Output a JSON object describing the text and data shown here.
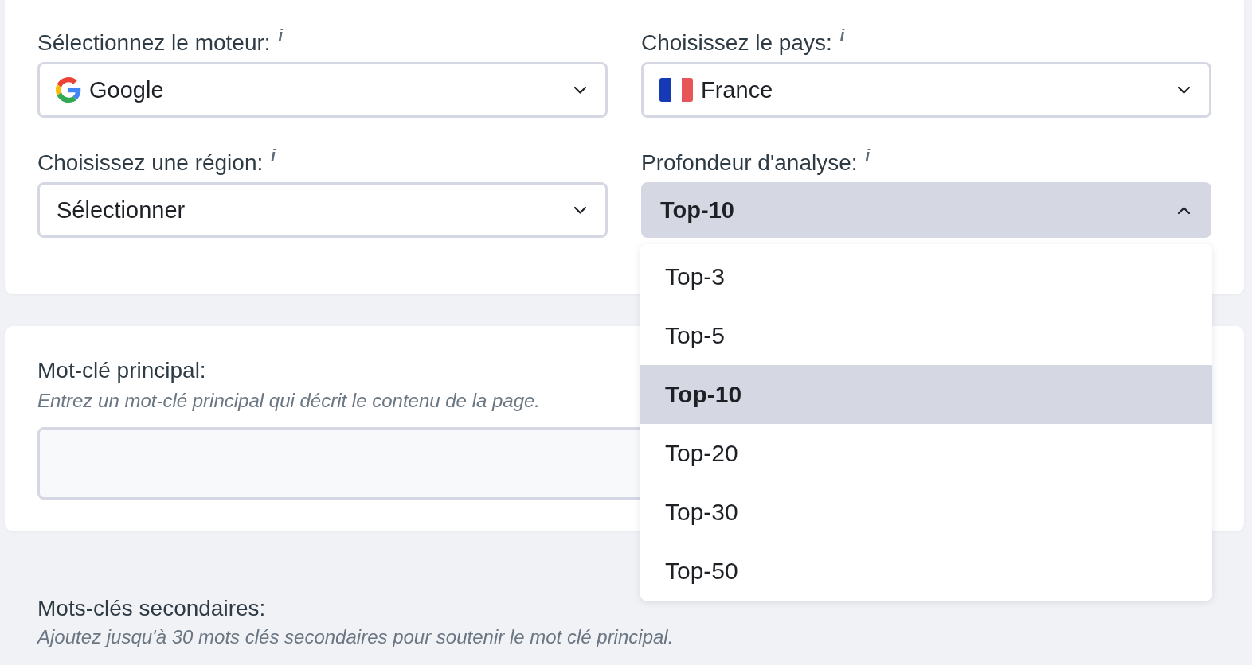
{
  "search_settings": {
    "fields": [
      {
        "kind": "engine",
        "label": "Sélectionnez le moteur:",
        "info": "i",
        "value": "Google",
        "expanded": false
      },
      {
        "kind": "country",
        "label": "Choisissez le pays:",
        "info": "i",
        "value": "France",
        "expanded": false
      },
      {
        "kind": "region",
        "label": "Choisissez une région:",
        "info": "i",
        "value": "Sélectionner",
        "expanded": false
      },
      {
        "kind": "depth",
        "label": "Profondeur d'analyse:",
        "info": "i",
        "value": "Top-10",
        "expanded": true,
        "options": [
          {
            "label": "Top-3",
            "selected": false
          },
          {
            "label": "Top-5",
            "selected": false
          },
          {
            "label": "Top-10",
            "selected": true
          },
          {
            "label": "Top-20",
            "selected": false
          },
          {
            "label": "Top-30",
            "selected": false
          },
          {
            "label": "Top-50",
            "selected": false
          }
        ]
      }
    ]
  },
  "main_keyword": {
    "label": "Mot-clé principal:",
    "hint": "Entrez un mot-clé principal qui décrit le contenu de la page."
  },
  "secondary_keywords": {
    "label": "Mots-clés secondaires:",
    "hint": "Ajoutez jusqu'à 30 mots clés secondaires pour soutenir le mot clé principal."
  }
}
